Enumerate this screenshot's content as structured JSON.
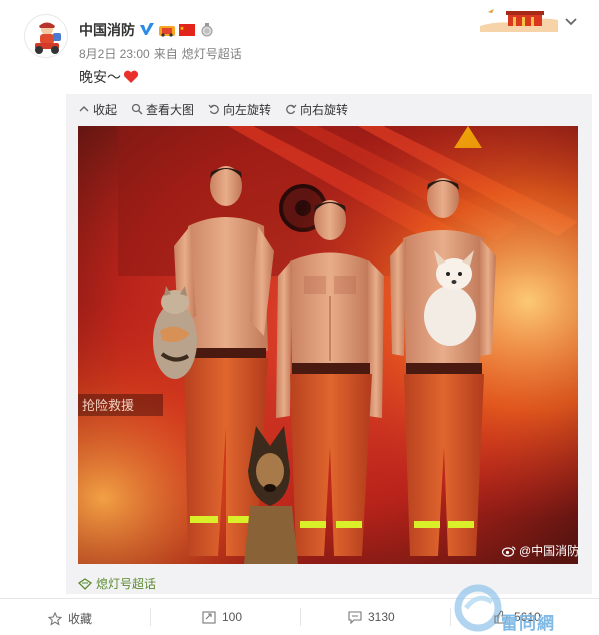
{
  "author": {
    "name": "中国消防",
    "verified_icon": "verified-v-icon",
    "badges": [
      "fire-truck-badge",
      "china-flag-badge",
      "medal-badge"
    ]
  },
  "meta": {
    "time": "8月2日 23:00",
    "source_prefix": "来自",
    "source": "熄灯号超话"
  },
  "post": {
    "text": "晚安～"
  },
  "media_toolbar": {
    "collapse": "收起",
    "view_large": "查看大图",
    "rotate_left": "向左旋转",
    "rotate_right": "向右旋转"
  },
  "photo": {
    "watermark": "@中国消防",
    "sign_text": "抢险救援"
  },
  "super_topic": {
    "label": "熄灯号超话"
  },
  "actions": {
    "favorite": "收藏",
    "repost": "100",
    "comment": "3130",
    "like": "5610"
  },
  "site_watermark": "雷同網",
  "colors": {
    "accent": "#eb7350",
    "link_green": "#5a8a2f",
    "photo_red": "#c8281e"
  }
}
